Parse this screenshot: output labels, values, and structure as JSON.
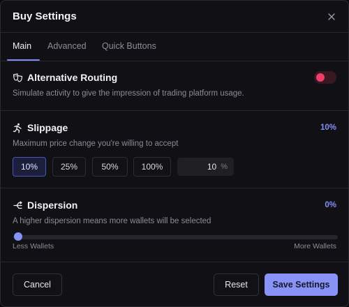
{
  "dialog": {
    "title": "Buy Settings"
  },
  "tabs": [
    {
      "label": "Main",
      "active": true
    },
    {
      "label": "Advanced",
      "active": false
    },
    {
      "label": "Quick Buttons",
      "active": false
    }
  ],
  "routing": {
    "title": "Alternative Routing",
    "description": "Simulate activity to give the impression of trading platform usage.",
    "enabled": false,
    "icon": "mask-icon"
  },
  "slippage": {
    "title": "Slippage",
    "value": "10%",
    "description": "Maximum price change you're willing to accept",
    "icon": "running-figure-icon",
    "options": [
      "10%",
      "25%",
      "50%",
      "100%"
    ],
    "selected_option": "10%",
    "custom_value": "10",
    "custom_unit": "%"
  },
  "dispersion": {
    "title": "Dispersion",
    "value": "0%",
    "description": "A higher dispersion means more wallets will be selected",
    "icon": "share-nodes-icon",
    "slider_level": 0,
    "min_label": "Less Wallets",
    "max_label": "More Wallets"
  },
  "footer": {
    "cancel_label": "Cancel",
    "reset_label": "Reset",
    "save_label": "Save Settings"
  },
  "colors": {
    "accent": "#8893f5",
    "toggle_knob": "#ee3e69",
    "background": "#111115"
  }
}
